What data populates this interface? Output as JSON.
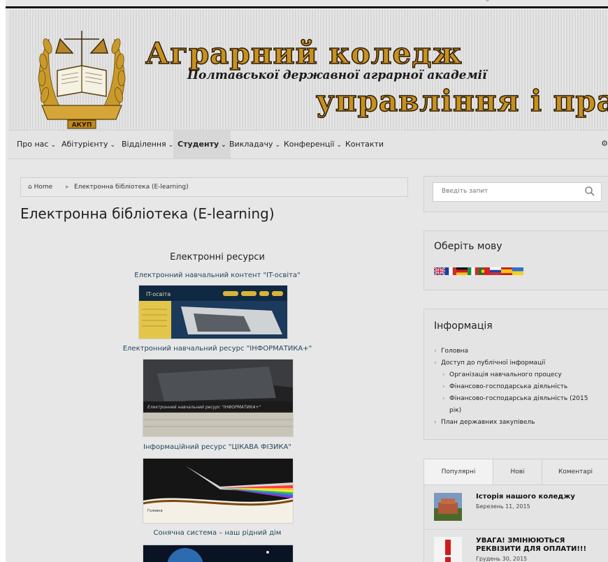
{
  "header": {
    "title_line1": "Аграрний коледж",
    "title_line2": "Полтавської державної аграрної академії",
    "title_line3": "управління і права",
    "logo_label": "АКУП"
  },
  "nav": {
    "items": [
      {
        "label": "Про нас",
        "caret": "⌄"
      },
      {
        "label": "Абітурієнту",
        "caret": "⌄"
      },
      {
        "label": "Відділення",
        "caret": "⌄"
      },
      {
        "label": "Студенту",
        "caret": "⌄"
      },
      {
        "label": "Викладачу",
        "caret": "⌄"
      },
      {
        "label": "Конференції",
        "caret": "⌄"
      },
      {
        "label": "Контакти",
        "caret": ""
      }
    ],
    "active_index": 3
  },
  "breadcrumb": {
    "home": "Home",
    "current": "Електронна бібліотека (E-learning)"
  },
  "page_title": "Електронна бібліотека (E-learning)",
  "resources": {
    "heading": "Електронні ресурси",
    "items": [
      {
        "label": "Електронний навчальний контент \"IT-освіта\"",
        "thumb_caption": "IT-освіта"
      },
      {
        "label": "Електронний навчальний ресурс \"ІНФОРМАТИКА+\"",
        "thumb_caption": "Електронний навчальний ресурс \"ІНФОРМАТИКА+\""
      },
      {
        "label": "Інформаційний ресурс \"ЦІКАВА ФІЗИКА\"",
        "thumb_caption": "Головна"
      },
      {
        "label": "Сонячна система – наш рідний дім",
        "thumb_caption": ""
      }
    ]
  },
  "sidebar": {
    "search": {
      "placeholder": "Введіть запит"
    },
    "language": {
      "title": "Оберіть мову",
      "flags": [
        "english-flag",
        "french-flag",
        "german-flag",
        "italian-flag",
        "portuguese-flag",
        "russian-flag",
        "spanish-flag",
        "ukrainian-flag"
      ]
    },
    "info": {
      "title": "Інформація",
      "items": [
        {
          "label": "Головна",
          "level": 0
        },
        {
          "label": "Доступ до публічної інформації",
          "level": 0
        },
        {
          "label": "Організація навчального процесу",
          "level": 1
        },
        {
          "label": "Фінансово-господарська діяльність",
          "level": 1
        },
        {
          "label": "Фінансово-господарська діяльність (2015 рік)",
          "level": 1
        },
        {
          "label": "План державних закупівель",
          "level": 0
        }
      ]
    },
    "tabs": {
      "labels": [
        "Популярні",
        "Нові",
        "Коментарі"
      ],
      "active_index": 0,
      "posts": [
        {
          "title": "Історія нашого коледжу",
          "date": "Березень 11, 2015"
        },
        {
          "title": "УВАГА! ЗМІНЮЮТЬСЯ РЕКВІЗИТИ ДЛЯ ОПЛАТИ!!!",
          "date": "Грудень 30, 2015"
        }
      ]
    }
  },
  "colors": {
    "title_gold": "#c8901f",
    "link_blue": "#23475c",
    "page_bg": "#e7e7e7"
  }
}
